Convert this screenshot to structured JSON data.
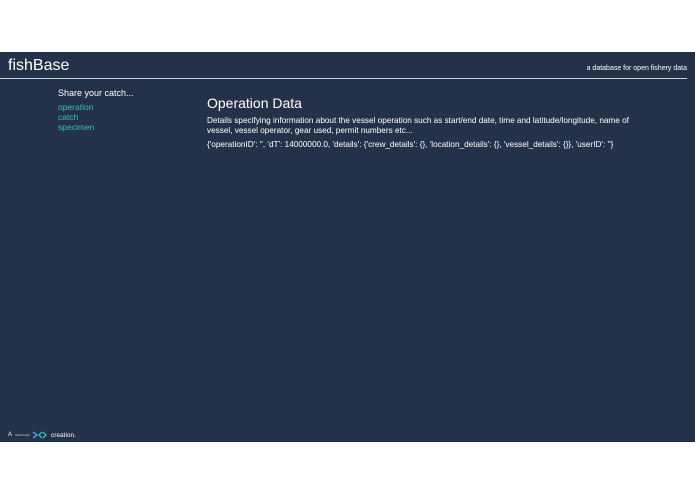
{
  "header": {
    "brand": "fishBase",
    "tagline": "a database for open fishery data"
  },
  "sidebar": {
    "title": "Share your catch...",
    "links": [
      {
        "label": "operation"
      },
      {
        "label": "catch"
      },
      {
        "label": "specimen"
      }
    ]
  },
  "main": {
    "title": "Operation Data",
    "description": "Details specifying information about the vessel operation such as start/end date, time and latitude/longitude, name of vessel, vessel operator, gear used, permit numbers etc...",
    "json_output": "{'operationID': '', 'dT': 14000000.0, 'details': {'crew_details': {}, 'location_details': {}, 'vessel_details': {}}, 'userID': ''}"
  },
  "footer": {
    "prefix": "A",
    "logo_text": "fisherhuber",
    "suffix": "creation."
  },
  "colors": {
    "background": "#243249",
    "accent": "#2fc6a2"
  },
  "icons": {
    "footer_logo": "fisher-logo-icon"
  }
}
